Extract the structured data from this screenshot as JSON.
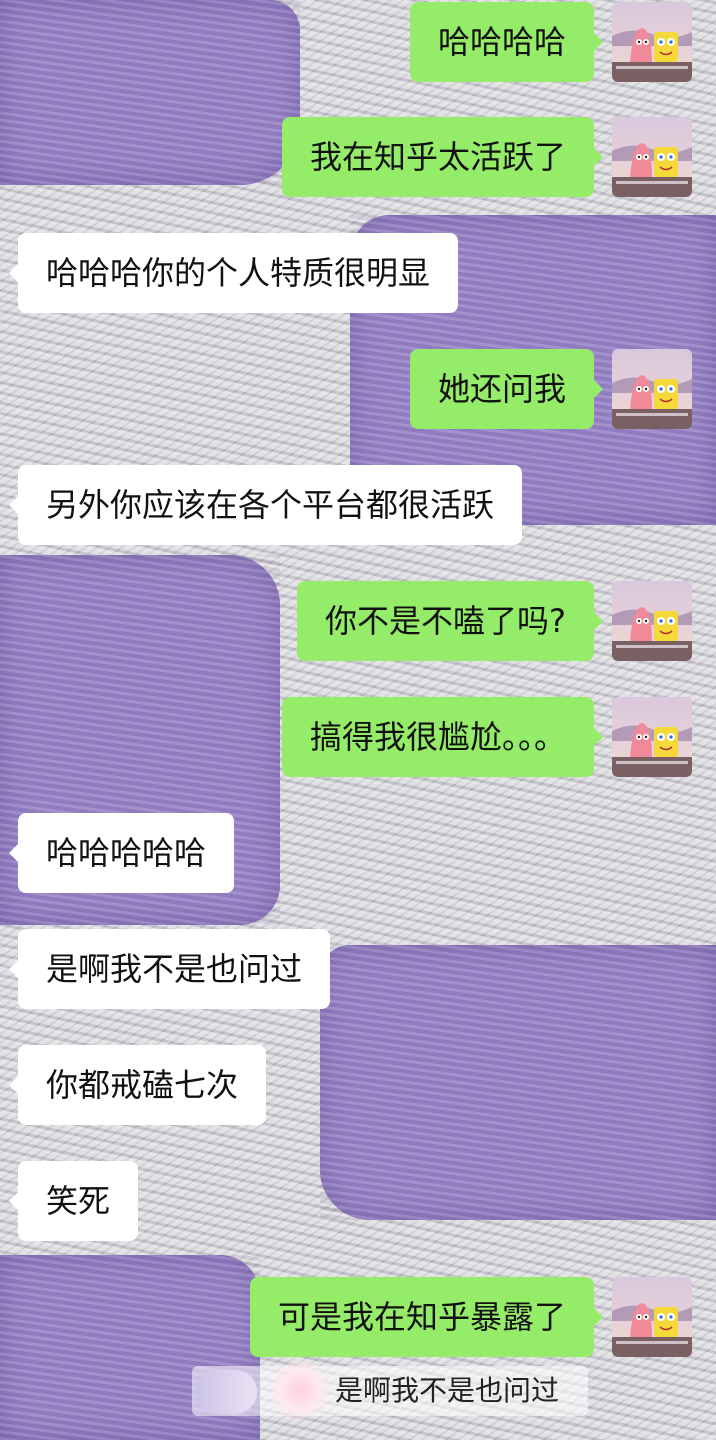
{
  "messages": [
    {
      "side": "right",
      "text": "哈哈哈哈"
    },
    {
      "side": "right",
      "text": "我在知乎太活跃了"
    },
    {
      "side": "left",
      "text": "哈哈哈你的个人特质很明显"
    },
    {
      "side": "right",
      "text": "她还问我"
    },
    {
      "side": "left",
      "text": "另外你应该在各个平台都很活跃"
    },
    {
      "side": "right",
      "text": "你不是不嗑了吗?"
    },
    {
      "side": "right",
      "text": "搞得我很尴尬。。。"
    },
    {
      "side": "left",
      "text": "哈哈哈哈哈"
    },
    {
      "side": "left",
      "text": "是啊我不是也问过"
    },
    {
      "side": "left",
      "text": "你都戒磕七次"
    },
    {
      "side": "left",
      "text": "笑死"
    },
    {
      "side": "right",
      "text": "可是我在知乎暴露了"
    }
  ],
  "quote_reply": {
    "text": "是啊我不是也问过"
  },
  "avatar": {
    "icon": "patrick-spongebob-avatar-icon"
  },
  "colors": {
    "sent_bubble": "#95ec69",
    "received_bubble": "#ffffff",
    "wall_purple": "#9a86c8"
  }
}
